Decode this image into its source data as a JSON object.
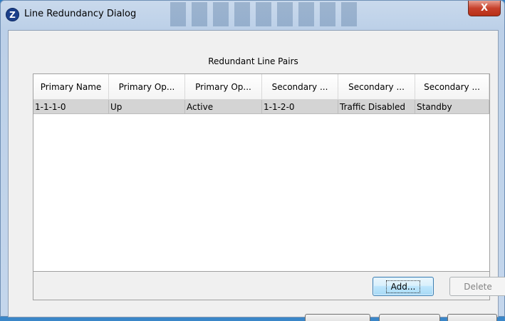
{
  "window": {
    "title": "Line Redundancy Dialog",
    "close_glyph": "X",
    "icon_letter": "Z"
  },
  "main": {
    "section_title": "Redundant Line Pairs",
    "table": {
      "columns": [
        "Primary Name",
        "Primary Op...",
        "Primary Op...",
        "Secondary ...",
        "Secondary ...",
        "Secondary ..."
      ],
      "rows": [
        [
          "1-1-1-0",
          "Up",
          "Active",
          "1-1-2-0",
          "Traffic Disabled",
          "Standby"
        ]
      ]
    },
    "buttons": {
      "add": "Add...",
      "delete": "Delete"
    }
  },
  "colors": {
    "selected_row": "#d4d4d4",
    "add_button_border": "#3c7fb1",
    "close_button": "#c7412c"
  },
  "icons": [
    "app-logo-icon",
    "close-icon"
  ]
}
